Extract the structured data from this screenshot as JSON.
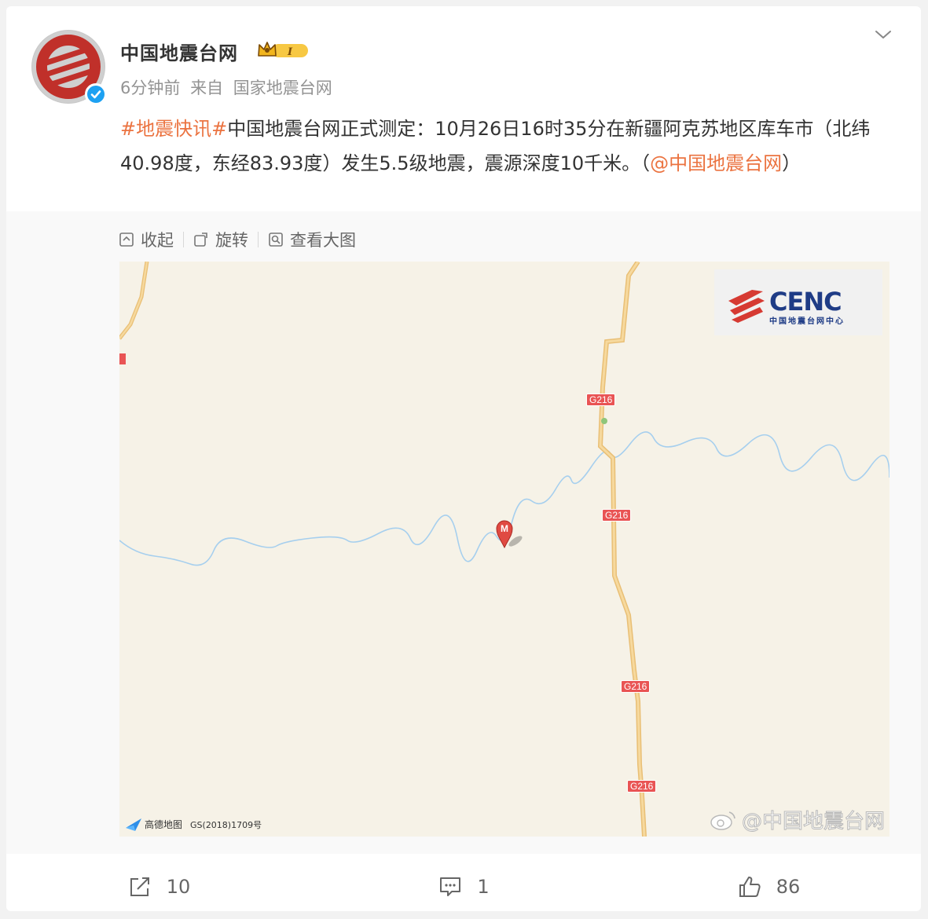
{
  "account": {
    "name": "中国地震台网",
    "level_badge": "I",
    "time": "6分钟前",
    "source_prefix": "来自",
    "source": "国家地震台网"
  },
  "post": {
    "hashtag": "#地震快讯#",
    "text": "中国地震台网正式测定：10月26日16时35分在新疆阿克苏地区库车市（北纬40.98度，东经83.93度）发生5.5级地震，震源深度10千米。（",
    "mention": "@中国地震台网",
    "text_end": "）"
  },
  "toolbar": {
    "collapse": "收起",
    "rotate": "旋转",
    "view_large": "查看大图"
  },
  "map": {
    "logo_text": "CENC",
    "logo_subtext": "中国地震台网中心",
    "road_label": "G216",
    "marker_letter": "M",
    "provider": "高德地图",
    "license": "GS(2018)1709号",
    "watermark": "@中国地震台网"
  },
  "actions": {
    "share_count": "10",
    "comment_count": "1",
    "like_count": "86"
  },
  "colors": {
    "link": "#eb7340",
    "brand_red": "#d63a32",
    "verified_blue": "#1da1f2"
  }
}
